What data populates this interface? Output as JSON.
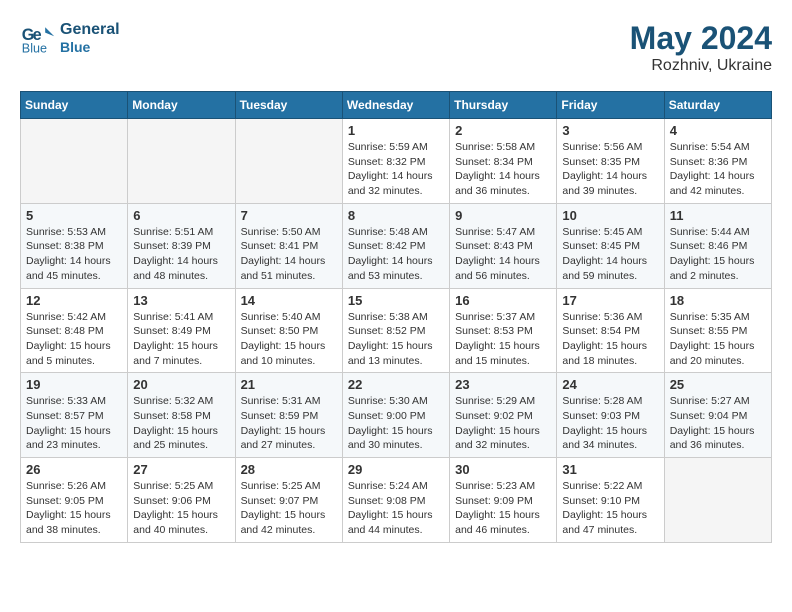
{
  "header": {
    "logo_line1": "General",
    "logo_line2": "Blue",
    "month": "May 2024",
    "location": "Rozhniv, Ukraine"
  },
  "weekdays": [
    "Sunday",
    "Monday",
    "Tuesday",
    "Wednesday",
    "Thursday",
    "Friday",
    "Saturday"
  ],
  "weeks": [
    [
      {
        "day": "",
        "info": ""
      },
      {
        "day": "",
        "info": ""
      },
      {
        "day": "",
        "info": ""
      },
      {
        "day": "1",
        "info": "Sunrise: 5:59 AM\nSunset: 8:32 PM\nDaylight: 14 hours and 32 minutes."
      },
      {
        "day": "2",
        "info": "Sunrise: 5:58 AM\nSunset: 8:34 PM\nDaylight: 14 hours and 36 minutes."
      },
      {
        "day": "3",
        "info": "Sunrise: 5:56 AM\nSunset: 8:35 PM\nDaylight: 14 hours and 39 minutes."
      },
      {
        "day": "4",
        "info": "Sunrise: 5:54 AM\nSunset: 8:36 PM\nDaylight: 14 hours and 42 minutes."
      }
    ],
    [
      {
        "day": "5",
        "info": "Sunrise: 5:53 AM\nSunset: 8:38 PM\nDaylight: 14 hours and 45 minutes."
      },
      {
        "day": "6",
        "info": "Sunrise: 5:51 AM\nSunset: 8:39 PM\nDaylight: 14 hours and 48 minutes."
      },
      {
        "day": "7",
        "info": "Sunrise: 5:50 AM\nSunset: 8:41 PM\nDaylight: 14 hours and 51 minutes."
      },
      {
        "day": "8",
        "info": "Sunrise: 5:48 AM\nSunset: 8:42 PM\nDaylight: 14 hours and 53 minutes."
      },
      {
        "day": "9",
        "info": "Sunrise: 5:47 AM\nSunset: 8:43 PM\nDaylight: 14 hours and 56 minutes."
      },
      {
        "day": "10",
        "info": "Sunrise: 5:45 AM\nSunset: 8:45 PM\nDaylight: 14 hours and 59 minutes."
      },
      {
        "day": "11",
        "info": "Sunrise: 5:44 AM\nSunset: 8:46 PM\nDaylight: 15 hours and 2 minutes."
      }
    ],
    [
      {
        "day": "12",
        "info": "Sunrise: 5:42 AM\nSunset: 8:48 PM\nDaylight: 15 hours and 5 minutes."
      },
      {
        "day": "13",
        "info": "Sunrise: 5:41 AM\nSunset: 8:49 PM\nDaylight: 15 hours and 7 minutes."
      },
      {
        "day": "14",
        "info": "Sunrise: 5:40 AM\nSunset: 8:50 PM\nDaylight: 15 hours and 10 minutes."
      },
      {
        "day": "15",
        "info": "Sunrise: 5:38 AM\nSunset: 8:52 PM\nDaylight: 15 hours and 13 minutes."
      },
      {
        "day": "16",
        "info": "Sunrise: 5:37 AM\nSunset: 8:53 PM\nDaylight: 15 hours and 15 minutes."
      },
      {
        "day": "17",
        "info": "Sunrise: 5:36 AM\nSunset: 8:54 PM\nDaylight: 15 hours and 18 minutes."
      },
      {
        "day": "18",
        "info": "Sunrise: 5:35 AM\nSunset: 8:55 PM\nDaylight: 15 hours and 20 minutes."
      }
    ],
    [
      {
        "day": "19",
        "info": "Sunrise: 5:33 AM\nSunset: 8:57 PM\nDaylight: 15 hours and 23 minutes."
      },
      {
        "day": "20",
        "info": "Sunrise: 5:32 AM\nSunset: 8:58 PM\nDaylight: 15 hours and 25 minutes."
      },
      {
        "day": "21",
        "info": "Sunrise: 5:31 AM\nSunset: 8:59 PM\nDaylight: 15 hours and 27 minutes."
      },
      {
        "day": "22",
        "info": "Sunrise: 5:30 AM\nSunset: 9:00 PM\nDaylight: 15 hours and 30 minutes."
      },
      {
        "day": "23",
        "info": "Sunrise: 5:29 AM\nSunset: 9:02 PM\nDaylight: 15 hours and 32 minutes."
      },
      {
        "day": "24",
        "info": "Sunrise: 5:28 AM\nSunset: 9:03 PM\nDaylight: 15 hours and 34 minutes."
      },
      {
        "day": "25",
        "info": "Sunrise: 5:27 AM\nSunset: 9:04 PM\nDaylight: 15 hours and 36 minutes."
      }
    ],
    [
      {
        "day": "26",
        "info": "Sunrise: 5:26 AM\nSunset: 9:05 PM\nDaylight: 15 hours and 38 minutes."
      },
      {
        "day": "27",
        "info": "Sunrise: 5:25 AM\nSunset: 9:06 PM\nDaylight: 15 hours and 40 minutes."
      },
      {
        "day": "28",
        "info": "Sunrise: 5:25 AM\nSunset: 9:07 PM\nDaylight: 15 hours and 42 minutes."
      },
      {
        "day": "29",
        "info": "Sunrise: 5:24 AM\nSunset: 9:08 PM\nDaylight: 15 hours and 44 minutes."
      },
      {
        "day": "30",
        "info": "Sunrise: 5:23 AM\nSunset: 9:09 PM\nDaylight: 15 hours and 46 minutes."
      },
      {
        "day": "31",
        "info": "Sunrise: 5:22 AM\nSunset: 9:10 PM\nDaylight: 15 hours and 47 minutes."
      },
      {
        "day": "",
        "info": ""
      }
    ]
  ]
}
